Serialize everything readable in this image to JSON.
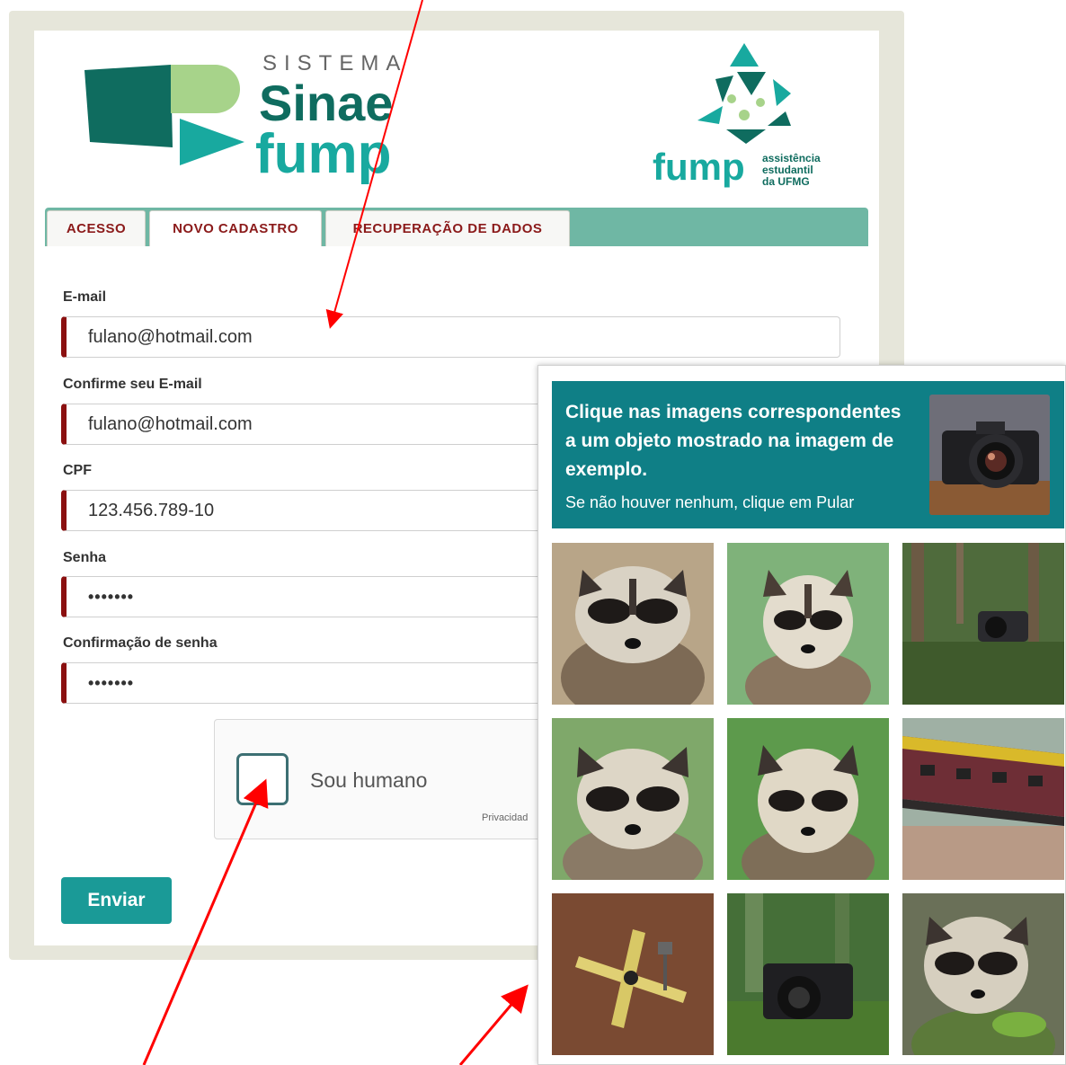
{
  "logo": {
    "sistema": "SISTEMA",
    "sinae": "Sinae",
    "fump": "fump",
    "fump_org": "fump",
    "org_line1": "assistência",
    "org_line2": "estudantil",
    "org_line3": "da UFMG"
  },
  "tabs": [
    {
      "label": "ACESSO"
    },
    {
      "label": "NOVO CADASTRO"
    },
    {
      "label": "RECUPERAÇÃO DE DADOS"
    }
  ],
  "form": {
    "email_label": "E-mail",
    "email_value": "fulano@hotmail.com",
    "email_confirm_label": "Confirme seu E-mail",
    "email_confirm_value": "fulano@hotmail.com",
    "cpf_label": "CPF",
    "cpf_value": "123.456.789-10",
    "password_label": "Senha",
    "password_value": "•••••••",
    "password_confirm_label": "Confirmação de senha",
    "password_confirm_value": "•••••••",
    "submit_label": "Enviar"
  },
  "captcha": {
    "checkbox_label": "Sou humano",
    "privacy": "Privacidad"
  },
  "challenge": {
    "title": "Clique nas imagens correspondentes a um objeto mostrado na imagem de exemplo.",
    "subtitle": "Se não houver nenhum, clique em Pular",
    "example": "camera",
    "tiles": [
      "raccoon",
      "raccoon",
      "camera-in-forest",
      "raccoon",
      "raccoon",
      "train",
      "toy-airplane",
      "camera-in-forest",
      "raccoon"
    ]
  },
  "colors": {
    "accent": "#1a9a97",
    "tab_bar": "#6fb7a4",
    "required_marker": "#8b1010",
    "challenge_header": "#0f7f86",
    "annotation_arrow": "#ff0000"
  }
}
